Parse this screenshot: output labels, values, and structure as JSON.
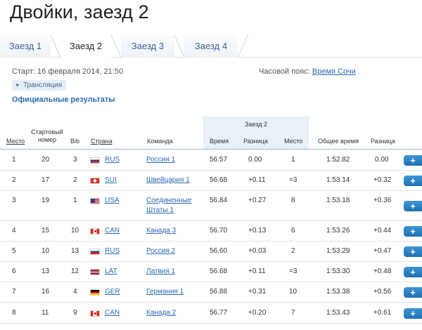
{
  "page_title": "Двойки, заезд 2",
  "tabs": [
    {
      "label": "Заезд 1",
      "active": false
    },
    {
      "label": "Заезд 2",
      "active": true
    },
    {
      "label": "Заезд 3",
      "active": false
    },
    {
      "label": "Заезд 4",
      "active": false
    }
  ],
  "meta": {
    "start": "Старт: 16 февраля 2014, 21:50",
    "timezone_label": "Часовой пояс:",
    "timezone_link": "Время Сочи"
  },
  "translation_button": "Трансляция",
  "official_results_label": "Официальные результаты",
  "table": {
    "group_header": "Заезд 2",
    "columns": {
      "place": "Место",
      "start_number": "Стартовый номер",
      "bib": "Bib",
      "country": "Страна",
      "team": "Команда",
      "time": "Время",
      "diff": "Разница",
      "run_place": "Место",
      "total_time": "Общее время",
      "total_diff": "Разница"
    },
    "rows": [
      {
        "place": "1",
        "start": "20",
        "bib": "3",
        "country": "RUS",
        "flag": "rus",
        "team": "Россия 1",
        "time": "56.57",
        "diff": "0.00",
        "run_place": "1",
        "total": "1:52.82",
        "total_diff": "0.00",
        "plus": "+"
      },
      {
        "place": "2",
        "start": "17",
        "bib": "2",
        "country": "SUI",
        "flag": "sui",
        "team": "Швейцария 1",
        "time": "56.68",
        "diff": "+0.11",
        "run_place": "=3",
        "total": "1:53.14",
        "total_diff": "+0.32",
        "plus": "+"
      },
      {
        "place": "3",
        "start": "19",
        "bib": "1",
        "country": "USA",
        "flag": "usa",
        "team_line1": "Соединенные",
        "team_line2": "Штаты 1",
        "time": "56.84",
        "diff": "+0.27",
        "run_place": "8",
        "total": "1:53.18",
        "total_diff": "+0.36",
        "plus": "+"
      },
      {
        "place": "4",
        "start": "15",
        "bib": "10",
        "country": "CAN",
        "flag": "can",
        "team": "Канада 3",
        "time": "56.70",
        "diff": "+0.13",
        "run_place": "6",
        "total": "1:53.26",
        "total_diff": "+0.44",
        "plus": "+"
      },
      {
        "place": "5",
        "start": "10",
        "bib": "13",
        "country": "RUS",
        "flag": "rus",
        "team": "Россия 2",
        "time": "56.60",
        "diff": "+0.03",
        "run_place": "2",
        "total": "1:53.29",
        "total_diff": "+0.47",
        "plus": "+"
      },
      {
        "place": "6",
        "start": "13",
        "bib": "12",
        "country": "LAT",
        "flag": "lat",
        "team": "Латвия 1",
        "time": "56.68",
        "diff": "+0.11",
        "run_place": "=3",
        "total": "1:53.30",
        "total_diff": "+0.48",
        "plus": "+"
      },
      {
        "place": "7",
        "start": "16",
        "bib": "4",
        "country": "GER",
        "flag": "ger",
        "team": "Германия 1",
        "time": "56.88",
        "diff": "+0.31",
        "run_place": "10",
        "total": "1:53.38",
        "total_diff": "+0.56",
        "plus": "+"
      },
      {
        "place": "8",
        "start": "11",
        "bib": "9",
        "country": "CAN",
        "flag": "can",
        "team": "Канада 2",
        "time": "56.77",
        "diff": "+0.20",
        "run_place": "7",
        "total": "1:53.43",
        "total_diff": "+0.61",
        "plus": "+"
      }
    ]
  },
  "colors": {
    "link": "#2a6ab0",
    "header_bg": "#e8f1f8",
    "plus_button": "#2a80c6"
  }
}
